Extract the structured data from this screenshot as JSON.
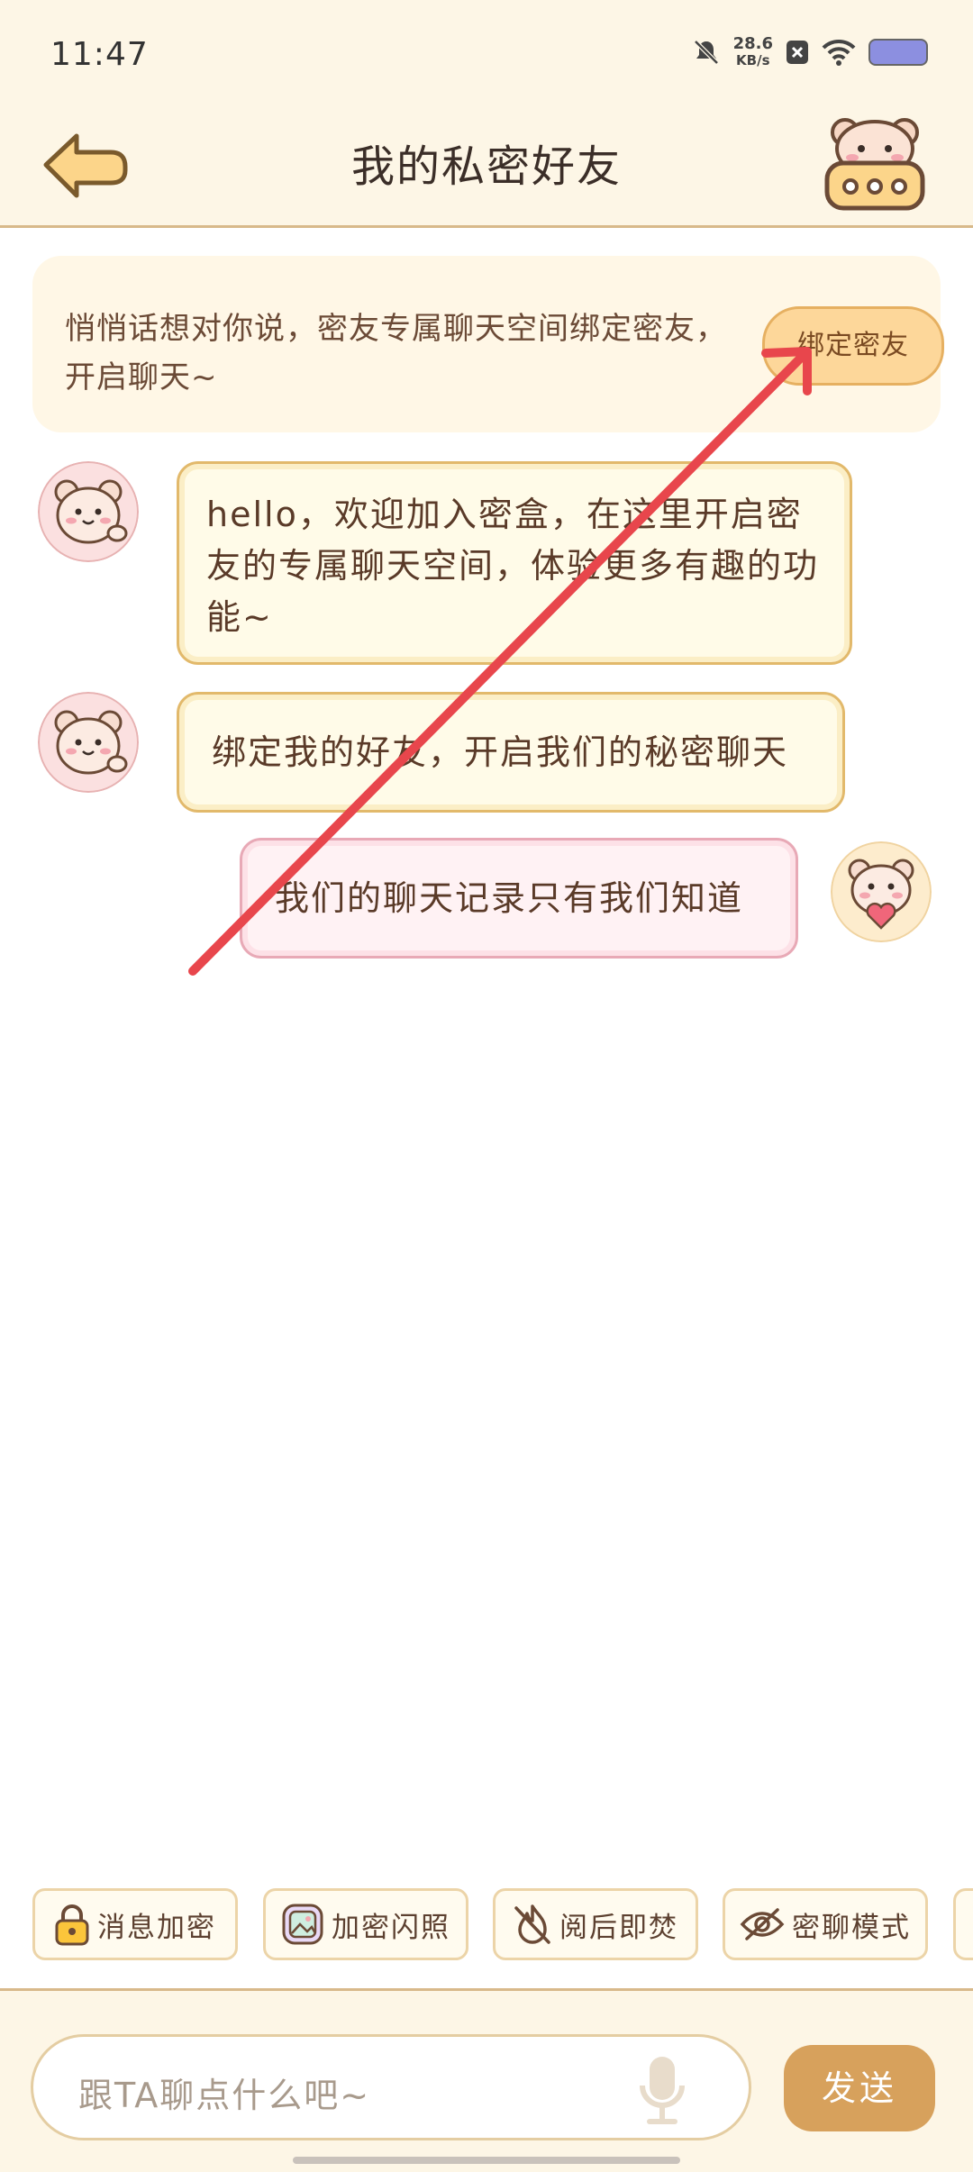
{
  "status_bar": {
    "time": "11:47",
    "net_speed_value": "28.6",
    "net_speed_unit": "KB/s"
  },
  "header": {
    "title": "我的私密好友",
    "back_icon": "back-arrow-icon",
    "menu_icon": "bear-menu-icon"
  },
  "notice": {
    "text": "悄悄话想对你说，密友专属聊天空间绑定密友，开启聊天~",
    "button_label": "绑定密友"
  },
  "messages": [
    {
      "side": "left",
      "text": "hello，欢迎加入密盒，在这里开启密友的专属聊天空间，体验更多有趣的功能~"
    },
    {
      "side": "left",
      "text": "绑定我的好友，开启我们的秘密聊天"
    },
    {
      "side": "right",
      "text": "我们的聊天记录只有我们知道"
    }
  ],
  "tools": [
    {
      "label": "消息加密",
      "icon": "lock-icon"
    },
    {
      "label": "加密闪照",
      "icon": "photo-icon"
    },
    {
      "label": "阅后即焚",
      "icon": "fire-off-icon"
    },
    {
      "label": "密聊模式",
      "icon": "eye-off-icon"
    }
  ],
  "input": {
    "placeholder": "跟TA聊点什么吧~",
    "send_label": "发送"
  },
  "colors": {
    "accent": "#d7a15c",
    "header_bg": "#fdf6e6",
    "annotation_arrow": "#e8464c"
  }
}
